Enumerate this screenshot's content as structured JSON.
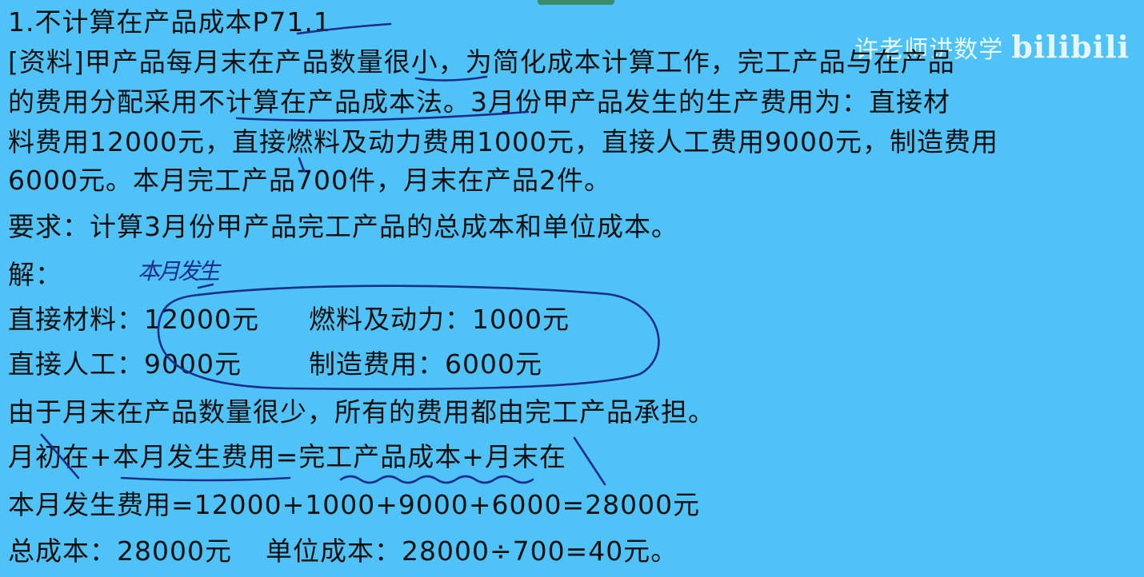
{
  "title": {
    "prefix": "1.不计算在产品成本",
    "ref": "P71.1"
  },
  "material": {
    "line1": "[资料]甲产品每月末在产品数量很小，为简化成本计算工作，完工产品与在产品",
    "line2": "的费用分配采用不计算在产品成本法。3月份甲产品发生的生产费用为：直接材",
    "line3": "料费用12000元，直接燃料及动力费用1000元，直接人工费用9000元，制造费用",
    "line4": "6000元。本月完工产品700件，月末在产品2件。"
  },
  "requirement": "要求：计算3月份甲产品完工产品的总成本和单位成本。",
  "solution": {
    "label": "解：",
    "handnote": "本月发生",
    "row1": {
      "label_a": "直接材料：",
      "value_a": "12000元",
      "label_b": "燃料及动力：",
      "value_b": "1000元"
    },
    "row2": {
      "label_a": "直接人工：",
      "value_a": "9000元",
      "label_b": "制造费用：",
      "value_b": "6000元"
    },
    "explanation": "由于月末在产品数量很少，所有的费用都由完工产品承担。",
    "formula": "月初在+本月发生费用=完工产品成本+月末在",
    "calc": "本月发生费用=12000+1000+9000+6000=28000元",
    "total": {
      "label": "总成本：",
      "value": "28000元",
      "unit_label": "单位成本：",
      "unit_value": "28000÷700=40元。"
    }
  },
  "watermark": {
    "text": "许老师讲数学",
    "logo": "bilibili"
  },
  "colors": {
    "background": "#4fc3f7",
    "ink": "#1a2d8a",
    "text": "#111111"
  }
}
